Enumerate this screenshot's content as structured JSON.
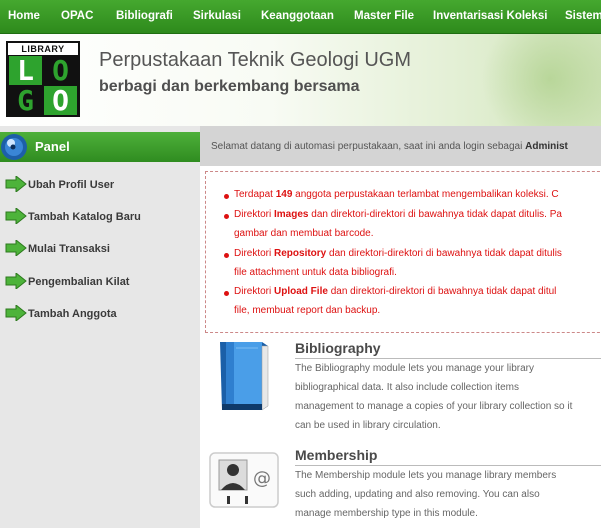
{
  "nav": {
    "items": [
      "Home",
      "OPAC",
      "Bibliografi",
      "Sirkulasi",
      "Keanggotaan",
      "Master File",
      "Inventarisasi Koleksi",
      "Sistem"
    ]
  },
  "header": {
    "logo_top": "LIBRARY",
    "logo_letters": [
      "L",
      "O",
      "G",
      "O"
    ],
    "title": "Perpustakaan Teknik Geologi UGM",
    "subtitle": "berbagi dan berkembang bersama"
  },
  "sidebar": {
    "panel_label": "Panel",
    "items": [
      {
        "label": "Ubah Profil User"
      },
      {
        "label": "Tambah Katalog Baru"
      },
      {
        "label": "Mulai Transaksi"
      },
      {
        "label": "Pengembalian Kilat"
      },
      {
        "label": "Tambah Anggota"
      }
    ]
  },
  "welcome": {
    "prefix": "Selamat datang di automasi perpustakaan, saat ini anda login sebagai ",
    "user": "Administ"
  },
  "alerts": {
    "a1_pre": "Terdapat ",
    "a1_count": "149",
    "a1_post": " anggota perpustakaan terlambat mengembalikan koleksi. C",
    "a2_pre": "Direktori ",
    "a2_bold": "Images",
    "a2_post": " dan direktori-direktori di bawahnya tidak dapat ditulis. Pa",
    "a2_line2": "gambar dan membuat barcode.",
    "a3_pre": "Direktori ",
    "a3_bold": "Repository",
    "a3_post": " dan direktori-direktori di bawahnya tidak dapat ditulis",
    "a3_line2": "file attachment untuk data bibliografi.",
    "a4_pre": "Direktori ",
    "a4_bold": "Upload File",
    "a4_post": " dan direktori-direktori di bawahnya tidak dapat ditul",
    "a4_line2": "file, membuat report dan backup."
  },
  "modules": {
    "bibliography": {
      "title": "Bibliography",
      "lines": [
        "The Bibliography module lets you manage your library",
        "bibliographical data. It also include collection items",
        "management to manage a copies of your library collection so it",
        "can be used in library circulation."
      ]
    },
    "membership": {
      "title": "Membership",
      "lines": [
        "The Membership module lets you manage library members",
        "such adding, updating and also removing. You can also",
        "manage membership type in this module."
      ]
    }
  },
  "colors": {
    "nav_green": "#3a9a26",
    "alert_red": "#dd1111",
    "sidebar_bg": "#e7e7e7"
  }
}
